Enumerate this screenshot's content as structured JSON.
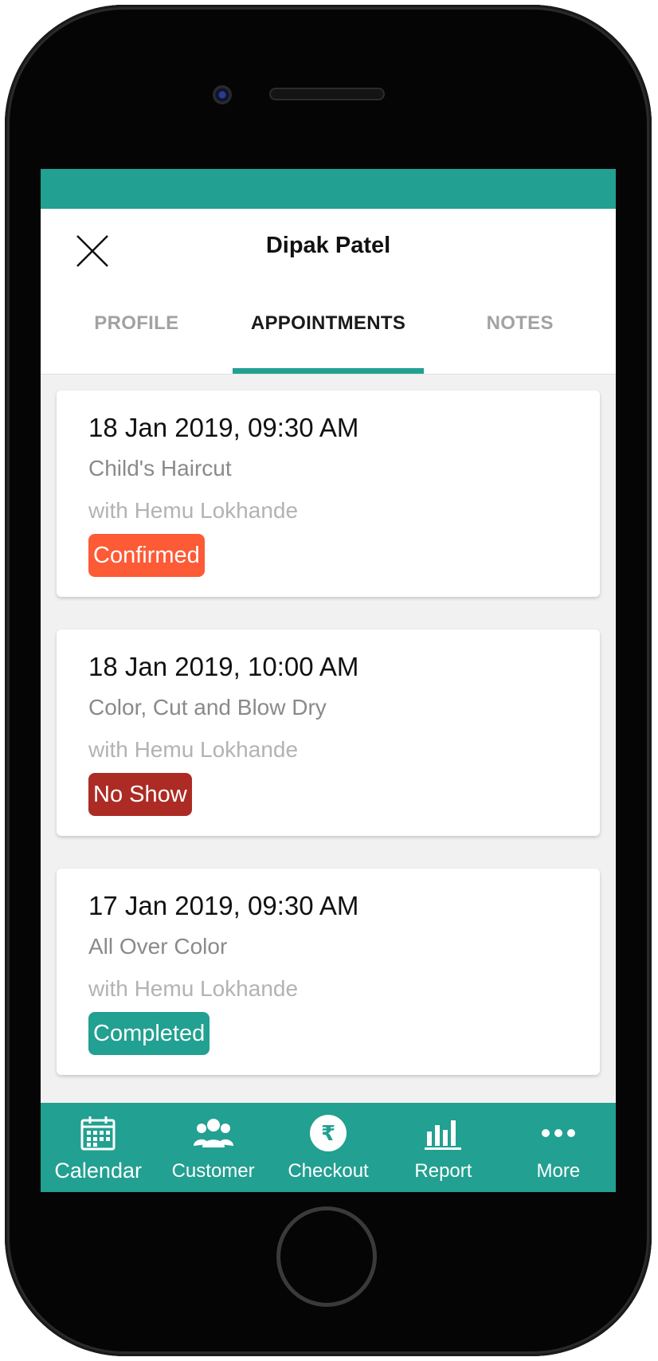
{
  "colors": {
    "accent": "#22a091",
    "confirmed": "#fd5a36",
    "no_show": "#ac2b25",
    "completed": "#22a091"
  },
  "header": {
    "title": "Dipak Patel",
    "close_icon": "close-icon"
  },
  "tabs": [
    {
      "label": "PROFILE",
      "active": false
    },
    {
      "label": "APPOINTMENTS",
      "active": true
    },
    {
      "label": "NOTES",
      "active": false
    }
  ],
  "appointments": [
    {
      "datetime": "18 Jan 2019, 09:30 AM",
      "service": "Child's Haircut",
      "staff": "with Hemu Lokhande",
      "status": "Confirmed",
      "status_color": "#fd5a36"
    },
    {
      "datetime": "18 Jan 2019, 10:00 AM",
      "service": "Color, Cut and Blow Dry",
      "staff": "with Hemu Lokhande",
      "status": "No Show",
      "status_color": "#ac2b25"
    },
    {
      "datetime": "17 Jan 2019, 09:30 AM",
      "service": "All Over Color",
      "staff": "with Hemu Lokhande",
      "status": "Completed",
      "status_color": "#22a091"
    }
  ],
  "bottom_nav": [
    {
      "label": "Calendar",
      "icon": "calendar-icon",
      "selected": true
    },
    {
      "label": "Customer",
      "icon": "customers-icon",
      "selected": false
    },
    {
      "label": "Checkout",
      "icon": "rupee-icon",
      "selected": false
    },
    {
      "label": "Report",
      "icon": "bar-chart-icon",
      "selected": false
    },
    {
      "label": "More",
      "icon": "more-dots-icon",
      "selected": false
    }
  ]
}
